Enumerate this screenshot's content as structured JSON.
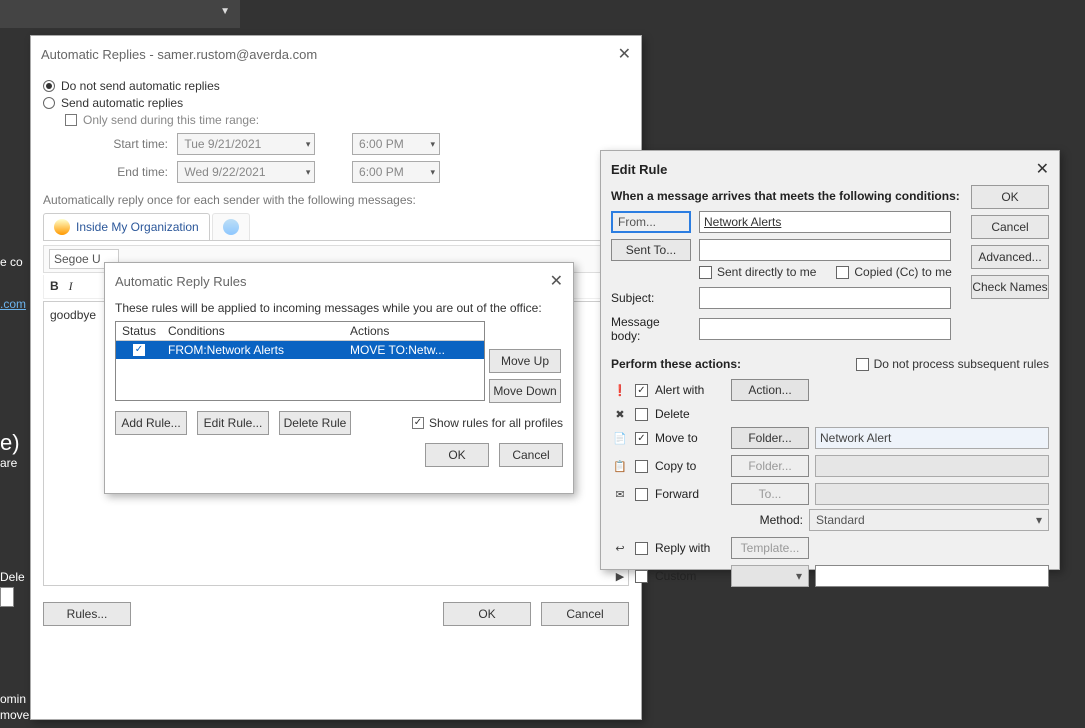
{
  "ribbon": {},
  "left": {
    "cfrag": "e co",
    "mfrag": ".com",
    "pfrag": "e)",
    "arefrag": "are",
    "delfrag": "Dele",
    "omfrag": "omin",
    "movfrag": "move"
  },
  "auto": {
    "title": "Automatic Replies - samer.rustom@averda.com",
    "opt_no": "Do not send automatic replies",
    "opt_yes": "Send automatic replies",
    "only_range": "Only send during this time range:",
    "start_label": "Start time:",
    "start_date": "Tue 9/21/2021",
    "start_time": "6:00 PM",
    "end_label": "End time:",
    "end_date": "Wed 9/22/2021",
    "end_time": "6:00 PM",
    "instr": "Automatically reply once for each sender with the following messages:",
    "tab_inside": "Inside My Organization",
    "font_name": "Segoe U",
    "editor_text": "goodbye",
    "rules_btn": "Rules...",
    "ok": "OK",
    "cancel": "Cancel"
  },
  "rules": {
    "title": "Automatic Reply Rules",
    "desc": "These rules will be applied to incoming messages while you are out of the office:",
    "h_status": "Status",
    "h_cond": "Conditions",
    "h_act": "Actions",
    "row_cond": "FROM:Network Alerts",
    "row_act": "MOVE TO:Netw...",
    "moveup": "Move Up",
    "movedown": "Move Down",
    "add": "Add Rule...",
    "edit": "Edit Rule...",
    "del": "Delete Rule",
    "showall": "Show rules for all profiles",
    "ok": "OK",
    "cancel": "Cancel"
  },
  "edit": {
    "title": "Edit Rule",
    "cond_label": "When a message arrives that meets the following conditions:",
    "from_btn": "From...",
    "from_val": "Network Alerts",
    "sent_btn": "Sent To...",
    "sent_direct": "Sent directly to me",
    "cc": "Copied (Cc) to me",
    "subject_lbl": "Subject:",
    "body_lbl": "Message body:",
    "ok": "OK",
    "cancel": "Cancel",
    "advanced": "Advanced...",
    "checknames": "Check Names",
    "nosubseq": "Do not process subsequent rules",
    "perform": "Perform these actions:",
    "alert": "Alert with",
    "action": "Action...",
    "delete": "Delete",
    "moveto": "Move to",
    "folder": "Folder...",
    "folder_val": "Network Alert",
    "copyto": "Copy to",
    "forward": "Forward",
    "to": "To...",
    "method_lbl": "Method:",
    "method_val": "Standard",
    "reply": "Reply with",
    "template": "Template...",
    "custom": "Custom"
  }
}
